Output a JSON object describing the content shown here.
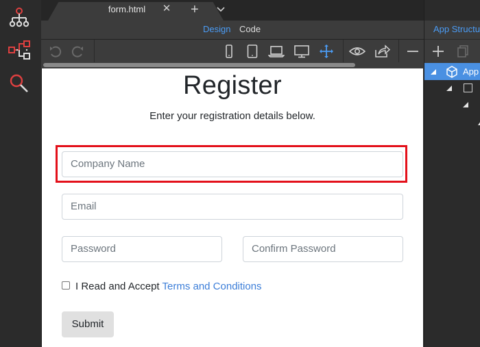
{
  "tab": {
    "title": "form.html",
    "close": "✕",
    "add": "+",
    "more": "⌄"
  },
  "view": {
    "design": "Design",
    "code": "Code"
  },
  "panel": {
    "title": "App Structure",
    "root_item": "App",
    "minus": "—"
  },
  "form": {
    "title": "Register",
    "subtitle": "Enter your registration details below.",
    "company_placeholder": "Company Name",
    "email_placeholder": "Email",
    "password_placeholder": "Password",
    "confirm_placeholder": "Confirm Password",
    "terms_prefix": "I Read and Accept ",
    "terms_link": "Terms and Conditions",
    "submit": "Submit"
  },
  "colors": {
    "accent": "#4b9cf5",
    "highlight": "#e3101a",
    "selected_row": "#4a90e2"
  }
}
